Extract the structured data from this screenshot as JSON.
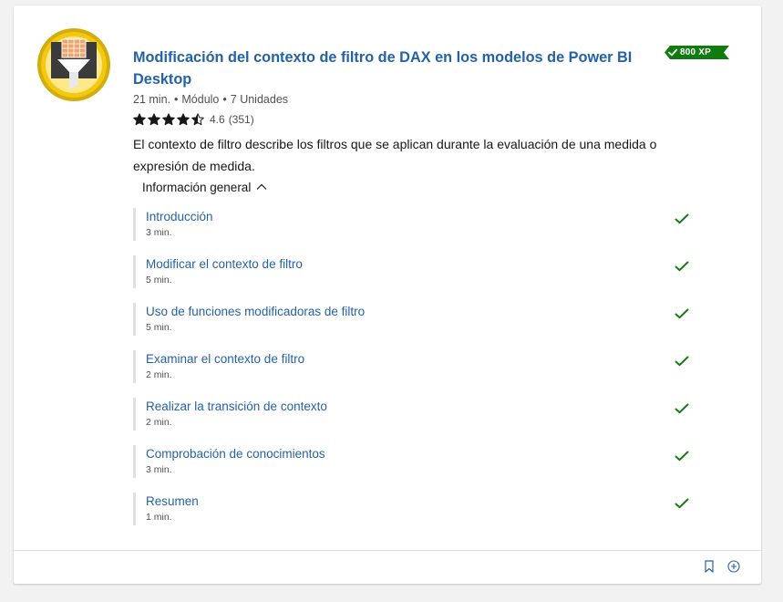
{
  "module": {
    "title": "Modificación del contexto de filtro de DAX en los modelos de Power BI Desktop",
    "xp_badge": "800 XP",
    "meta": {
      "duration": "21 min.",
      "separator": "•",
      "type": "Módulo",
      "units": "7 Unidades"
    },
    "rating": {
      "value": "4.6",
      "count": "(351)",
      "stars": 4.5
    },
    "description": "El contexto de filtro describe los filtros que se aplican durante la evaluación de una medida o expresión de medida.",
    "overview_label": "Información general",
    "units": [
      {
        "title": "Introducción",
        "duration": "3 min.",
        "completed": true
      },
      {
        "title": "Modificar el contexto de filtro",
        "duration": "5 min.",
        "completed": true
      },
      {
        "title": "Uso de funciones modificadoras de filtro",
        "duration": "5 min.",
        "completed": true
      },
      {
        "title": "Examinar el contexto de filtro",
        "duration": "2 min.",
        "completed": true
      },
      {
        "title": "Realizar la transición de contexto",
        "duration": "2 min.",
        "completed": true
      },
      {
        "title": "Comprobación de conocimientos",
        "duration": "3 min.",
        "completed": true
      },
      {
        "title": "Resumen",
        "duration": "1 min.",
        "completed": true
      }
    ]
  },
  "icons": {
    "badge": "filter-funnel-trophy-icon",
    "xp_check": "check-icon",
    "unit_check": "check-icon",
    "overview_toggle": "chevron-up-icon",
    "bookmark": "bookmark-icon",
    "add": "add-circle-icon"
  },
  "colors": {
    "link": "#2462a8",
    "xp_badge": "#107c10",
    "check": "#107c10",
    "badge_ring": "#f2c811",
    "badge_ring_outer": "#c9a60a",
    "badge_dark": "#3b3b3b",
    "star": "#171717"
  }
}
